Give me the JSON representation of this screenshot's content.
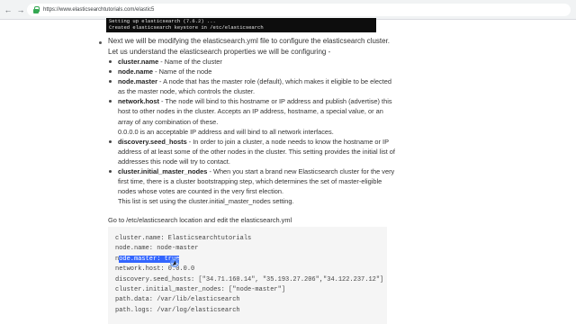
{
  "browser": {
    "url": "https://www.elasticsearchtutorials.com/elastic5"
  },
  "terminal": {
    "lines": [
      "Setting up elasticsearch (7.6.2) ...",
      "Created elasticsearch keystore in /etc/elasticsearch"
    ]
  },
  "intro": {
    "line1": "Next we will be modifying the elasticsearch.yml file to configure the elasticsearch cluster.",
    "line2": "Let us understand the elasticsearch properties we will be configuring -"
  },
  "properties": [
    {
      "name": "cluster.name",
      "desc": " - Name of the cluster"
    },
    {
      "name": "node.name",
      "desc": " - Name of the node"
    },
    {
      "name": "node.master",
      "desc": " - A node that has the master role (default), which makes it eligible to be elected as the master node, which controls the cluster."
    },
    {
      "name": "network.host",
      "desc": " - The node will bind to this hostname or IP address and publish (advertise) this host to other nodes in the cluster. Accepts an IP address, hostname, a special value, or an array of any combination of these.",
      "extra": "0.0.0.0 is an acceptable IP address and will bind to all network interfaces."
    },
    {
      "name": "discovery.seed_hosts",
      "desc": " - In order to join a cluster, a node needs to know the hostname or IP address of at least some of the other nodes in the cluster. This setting provides the initial list of addresses this node will try to contact."
    },
    {
      "name": "cluster.initial_master_nodes",
      "desc": " - When you start a brand new Elasticsearch cluster for the very first time, there is a cluster bootstrapping step, which determines the set of master-eligible nodes whose votes are counted in the very first election.",
      "extra": "This list is set using the cluster.initial_master_nodes setting."
    }
  ],
  "goto_text": "Go to /etc/elasticsearch location and edit the elasticsearch.yml",
  "code": {
    "line1": "cluster.name: Elasticsearchtutorials",
    "line2": "node.name: node-master",
    "line3_pre": "n",
    "line3_sel": "ode.master: true",
    "line4": "network.host: 0.0.0.0",
    "line5": "discovery.seed_hosts: [\"34.71.160.14\", \"35.193.27.206\",\"34.122.237.12\"]",
    "line6": "cluster.initial_master_nodes: [\"node-master\"]",
    "line7": "path.data: /var/lib/elasticsearch",
    "line8": "path.logs: /var/log/elasticsearch"
  },
  "colors": {
    "selection": "#3366ff",
    "code_bg": "#f5f5f5",
    "terminal_bg": "#0d0d0d"
  }
}
